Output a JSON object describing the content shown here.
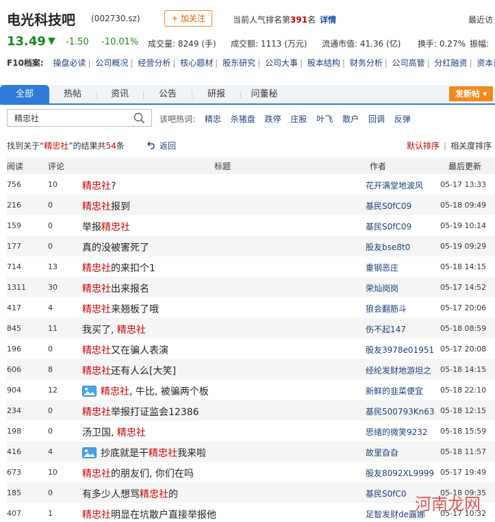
{
  "header": {
    "bar_name": "电光科技吧",
    "code": "(002730.sz)",
    "follow_label": "+ 加关注",
    "rank_prefix": "当前人气排名第",
    "rank_number": "391",
    "rank_suffix": "名",
    "detail_label": "详情",
    "recent_label": "最近访"
  },
  "quote": {
    "price": "13.49",
    "change": "-1.50",
    "change_pct": "-10.01%",
    "volume": "成交量: 8249 (手)",
    "turnover": "成交额: 1113 (万元)",
    "market_value": "流通市值: 41.36 (亿)",
    "turnover_rate": "换手: 0.27%",
    "amplitude": "振幅:",
    "down_color": "#1a8a1a"
  },
  "f10": {
    "label": "F10档案:",
    "links": [
      "操盘必读",
      "公司概况",
      "经营分析",
      "核心题材",
      "股东研究",
      "公司大事",
      "股本结构",
      "财务分析",
      "公司高管",
      "分红融资",
      "资本运作"
    ]
  },
  "tabs": [
    {
      "label": "全部",
      "active": true
    },
    {
      "label": "热帖"
    },
    {
      "label": "资讯"
    },
    {
      "label": "公告"
    },
    {
      "label": "研报"
    },
    {
      "label": "问董秘"
    }
  ],
  "post_button": "发新帖 ▾",
  "search": {
    "value": "精忠社",
    "hot_label": "该吧热词:",
    "hot_words": [
      "精忠",
      "杀猪盘",
      "跌停",
      "庄股",
      "叶飞",
      "散户",
      "回调",
      "反弹"
    ]
  },
  "results": {
    "prefix": "找到关于“",
    "keyword": "精忠社",
    "middle": "”的结果共",
    "count": "54",
    "suffix": "条",
    "back_label": "返回",
    "sort_default": "默认排序",
    "sort_relevance": "相关度排序"
  },
  "table": {
    "headers": {
      "read": "阅读",
      "comment": "评论",
      "title": "标题",
      "author": "作者",
      "updated": "最后更新"
    },
    "rows": [
      {
        "read": "756",
        "comment": "10",
        "title": [
          {
            "t": "精忠社",
            "h": true
          },
          {
            "t": "?"
          }
        ],
        "author": "花开满堂地波风",
        "time": "05-17 13:33"
      },
      {
        "read": "216",
        "comment": "0",
        "title": [
          {
            "t": "精忠社",
            "h": true
          },
          {
            "t": "报到"
          }
        ],
        "author": "基民S0fC09",
        "time": "05-18 09:49"
      },
      {
        "read": "159",
        "comment": "0",
        "title": [
          {
            "t": "举报"
          },
          {
            "t": "精忠社",
            "h": true
          }
        ],
        "author": "基民S0fC09",
        "time": "05-19 10:14"
      },
      {
        "read": "177",
        "comment": "0",
        "title": [
          {
            "t": "真的没被害死了"
          }
        ],
        "author": "股友bse8t0",
        "time": "05-19 09:29"
      },
      {
        "read": "714",
        "comment": "13",
        "title": [
          {
            "t": "精忠社",
            "h": true
          },
          {
            "t": "的来扣个1"
          }
        ],
        "author": "重钢恶庄",
        "time": "05-18 14:15"
      },
      {
        "read": "1311",
        "comment": "30",
        "title": [
          {
            "t": "精忠社",
            "h": true
          },
          {
            "t": "出来报名"
          }
        ],
        "author": "荣灿岗岗",
        "time": "05-17 14:52"
      },
      {
        "read": "417",
        "comment": "4",
        "title": [
          {
            "t": "精忠社",
            "h": true
          },
          {
            "t": "来翘板了哦"
          }
        ],
        "author": "狼会翻筋斗",
        "time": "05-17 20:06"
      },
      {
        "read": "845",
        "comment": "11",
        "title": [
          {
            "t": "我买了, "
          },
          {
            "t": "精忠社",
            "h": true
          }
        ],
        "author": "伤不起147",
        "time": "05-18 08:59"
      },
      {
        "read": "196",
        "comment": "0",
        "title": [
          {
            "t": "精忠社",
            "h": true
          },
          {
            "t": "又在骗人表演"
          }
        ],
        "author": "股友3978e01951",
        "time": "05-17 20:08"
      },
      {
        "read": "606",
        "comment": "8",
        "title": [
          {
            "t": "精忠社",
            "h": true
          },
          {
            "t": "还有人么[大笑]"
          }
        ],
        "author": "经纶发财地游坦之",
        "time": "05-18 14:15"
      },
      {
        "read": "904",
        "comment": "12",
        "pic": true,
        "title": [
          {
            "t": "精忠社",
            "h": true
          },
          {
            "t": ", 牛比, 被骗两个板"
          }
        ],
        "author": "新鲜的韭菜便宜",
        "time": "05-18 22:10"
      },
      {
        "read": "234",
        "comment": "0",
        "title": [
          {
            "t": "精忠社",
            "h": true
          },
          {
            "t": "举报打证监会12386"
          }
        ],
        "author": "基民500793Kn63",
        "time": "05-18 12:15"
      },
      {
        "read": "198",
        "comment": "0",
        "title": [
          {
            "t": "汤卫国, "
          },
          {
            "t": "精忠社",
            "h": true
          }
        ],
        "author": "思绪的微笑9232",
        "time": "05-18 15:59"
      },
      {
        "read": "416",
        "comment": "4",
        "pic": true,
        "title": [
          {
            "t": "抄底就是干"
          },
          {
            "t": "精忠社",
            "h": true
          },
          {
            "t": "我来啦"
          }
        ],
        "author": "故里旮旮",
        "time": "05-18 11:57"
      },
      {
        "read": "673",
        "comment": "10",
        "title": [
          {
            "t": "精忠社",
            "h": true
          },
          {
            "t": "的朋友们, 你们在吗"
          }
        ],
        "author": "股友8092XL9999",
        "time": "05-17 19:49"
      },
      {
        "read": "185",
        "comment": "0",
        "title": [
          {
            "t": "有多少人想骂"
          },
          {
            "t": "精忠社",
            "h": true
          },
          {
            "t": "的"
          }
        ],
        "author": "基民S0fC0",
        "time": "05-18 09:35"
      },
      {
        "read": "407",
        "comment": "1",
        "title": [
          {
            "t": "精忠社",
            "h": true
          },
          {
            "t": "明显在坑散户直接举报他"
          }
        ],
        "author": "足智发财de露娜",
        "time": "05-17 10:32"
      }
    ]
  },
  "watermark": {
    "text": "河南龙网"
  }
}
